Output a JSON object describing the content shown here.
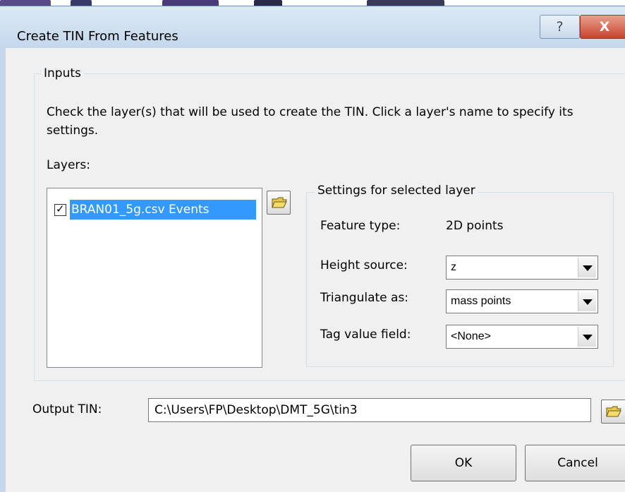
{
  "window": {
    "title": "Create TIN From Features",
    "help_label": "?",
    "close_label": "X"
  },
  "inputs": {
    "group_label": "Inputs",
    "instructions": "Check the layer(s) that will be used to create the TIN.  Click a layer's name to specify its settings.",
    "layers_label": "Layers:",
    "layers": [
      {
        "name": "BRAN01_5g.csv Events",
        "checked": true,
        "selected": true
      }
    ]
  },
  "settings": {
    "group_label": "Settings for selected layer",
    "feature_type_label": "Feature type:",
    "feature_type_value": "2D points",
    "height_source_label": "Height source:",
    "height_source_value": "z",
    "triangulate_label": "Triangulate as:",
    "triangulate_value": "mass points",
    "tag_label": "Tag value field:",
    "tag_value": "<None>"
  },
  "output": {
    "label": "Output TIN:",
    "value": "C:\\Users\\FP\\Desktop\\DMT_5G\\tin3"
  },
  "buttons": {
    "ok": "OK",
    "cancel": "Cancel"
  },
  "colors": {
    "selection": "#3399ff",
    "dialog_bg": "#f0f0f0",
    "close_red": "#c7432b"
  },
  "icons": [
    "help-icon",
    "close-icon",
    "open-folder-icon",
    "checkbox-checked-icon",
    "dropdown-arrow-icon"
  ]
}
